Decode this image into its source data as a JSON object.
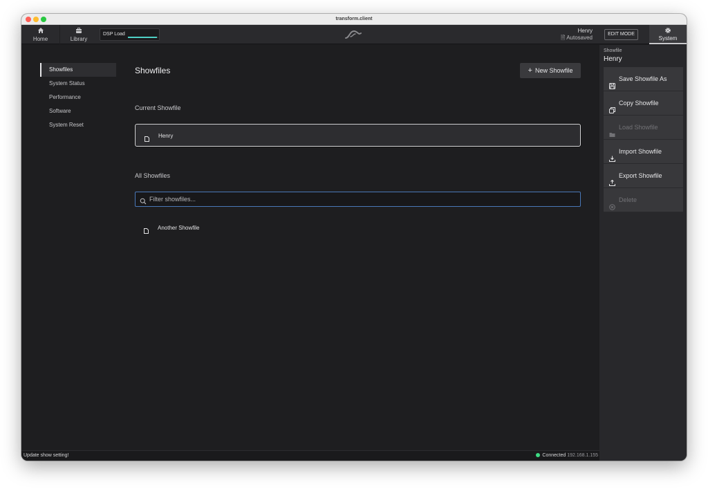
{
  "window": {
    "title": "transform.client"
  },
  "toolbar": {
    "home_label": "Home",
    "library_label": "Library",
    "dsp_label": "DSP Load",
    "dsp_load": 0.95,
    "user_name": "Henry",
    "autosave_status": "Autosaved",
    "edit_mode_label": "EDIT MODE",
    "system_label": "System"
  },
  "sidebar": {
    "items": [
      {
        "label": "Showfiles"
      },
      {
        "label": "System Status"
      },
      {
        "label": "Performance"
      },
      {
        "label": "Software"
      },
      {
        "label": "System Reset"
      }
    ]
  },
  "main": {
    "title": "Showfiles",
    "new_button_label": "New Showfile",
    "current_section_label": "Current Showfile",
    "current_showfile": "Henry",
    "all_section_label": "All Showfiles",
    "filter_placeholder": "Filter showfiles...",
    "showfiles": [
      "Another Showfile"
    ]
  },
  "panel": {
    "label": "Showfile",
    "title": "Henry",
    "actions": [
      {
        "label": "Save Showfile As",
        "icon": "save-icon",
        "enabled": true
      },
      {
        "label": "Copy Showfile",
        "icon": "copy-icon",
        "enabled": true
      },
      {
        "label": "Load Showfile",
        "icon": "folder-icon",
        "enabled": false
      },
      {
        "label": "Import Showfile",
        "icon": "import-icon",
        "enabled": true
      },
      {
        "label": "Export Showfile",
        "icon": "export-icon",
        "enabled": true
      },
      {
        "label": "Delete",
        "icon": "delete-icon",
        "enabled": false
      }
    ]
  },
  "statusbar": {
    "message": "Update show setting!",
    "connection_label": "Connected",
    "ip": "192.168.1.155"
  },
  "colors": {
    "accent": "#4fd1c5",
    "focus_border": "#4a78b8",
    "connected": "#3ddc84"
  }
}
